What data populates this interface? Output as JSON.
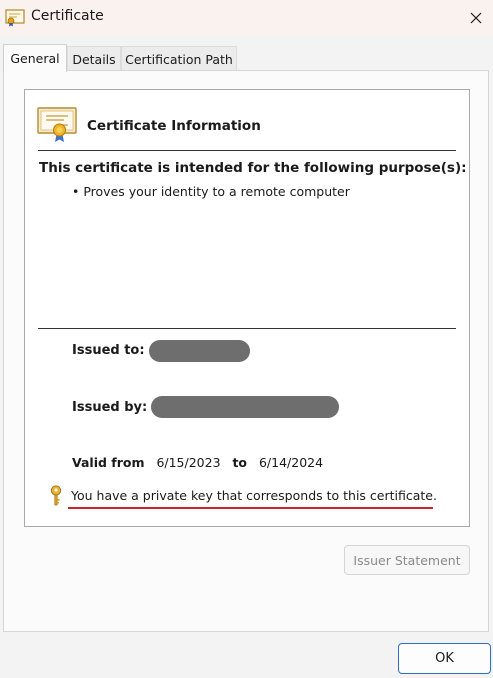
{
  "window": {
    "title": "Certificate",
    "title_icon": "certificate-icon",
    "close_icon": "close-icon"
  },
  "tabs": [
    {
      "label": "General",
      "active": true
    },
    {
      "label": "Details",
      "active": false
    },
    {
      "label": "Certification Path",
      "active": false
    }
  ],
  "general": {
    "info_title": "Certificate Information",
    "purpose_heading": "This certificate is intended for the following purpose(s):",
    "purposes": [
      "• Proves your identity to a remote computer"
    ],
    "issued_to_label": "Issued to:",
    "issued_by_label": "Issued by:",
    "valid_from_label": "Valid from",
    "valid_from": "6/15/2023",
    "valid_to_label": "to",
    "valid_to": "6/14/2024",
    "private_key_text": "You have a private key that corresponds to this certificate.",
    "key_icon": "key-icon"
  },
  "buttons": {
    "issuer_statement": "Issuer Statement",
    "issuer_statement_enabled": false,
    "ok": "OK"
  },
  "colors": {
    "annotation_underline": "#d0202a",
    "ok_border": "#2b6fc7",
    "redaction": "#6e6e6e"
  }
}
